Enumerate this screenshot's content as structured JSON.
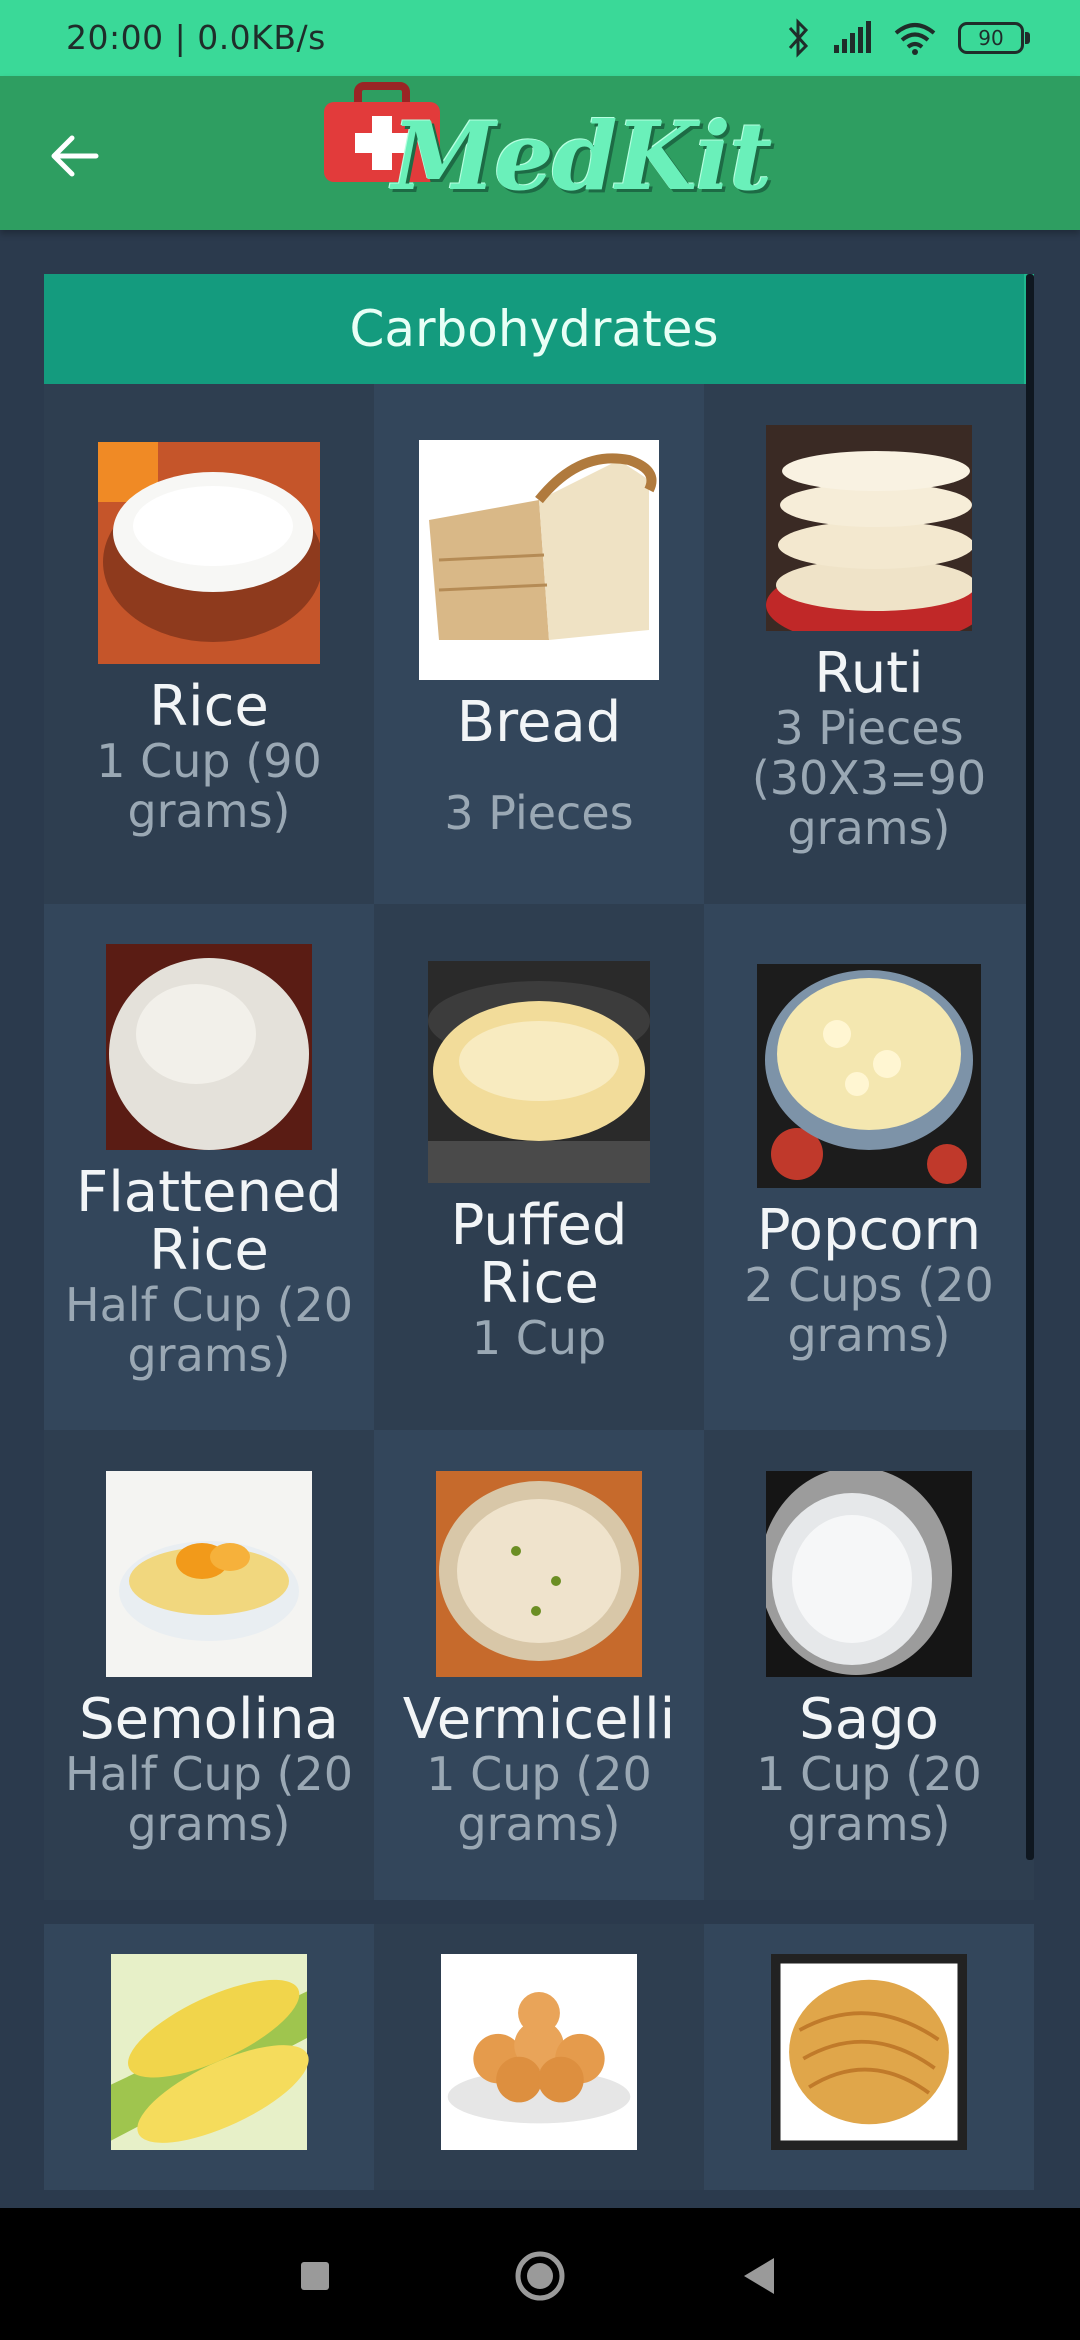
{
  "status": {
    "time": "20:00 | 0.0KB/s",
    "battery": "90"
  },
  "app": {
    "logo_text": "MedKit"
  },
  "section_title": "Carbohydrates",
  "rows": [
    [
      {
        "name": "Rice",
        "qty": "1 Cup (90 grams)"
      },
      {
        "name": "Bread",
        "qty": "3 Pieces"
      },
      {
        "name": "Ruti",
        "qty": "3 Pieces (30X3=90 grams)"
      }
    ],
    [
      {
        "name": "Flattened Rice",
        "qty": "Half Cup (20 grams)"
      },
      {
        "name": "Puffed Rice",
        "qty": "1 Cup"
      },
      {
        "name": "Popcorn",
        "qty": "2 Cups (20 grams)"
      }
    ],
    [
      {
        "name": "Semolina",
        "qty": "Half Cup (20 grams)"
      },
      {
        "name": "Vermicelli",
        "qty": "1 Cup (20 grams)"
      },
      {
        "name": "Sago",
        "qty": "1 Cup (20 grams)"
      }
    ]
  ],
  "colors": {
    "status": "#3ad998",
    "appbar": "#2e9e61",
    "header": "#149b7e",
    "bg": "#2b3a4d"
  }
}
